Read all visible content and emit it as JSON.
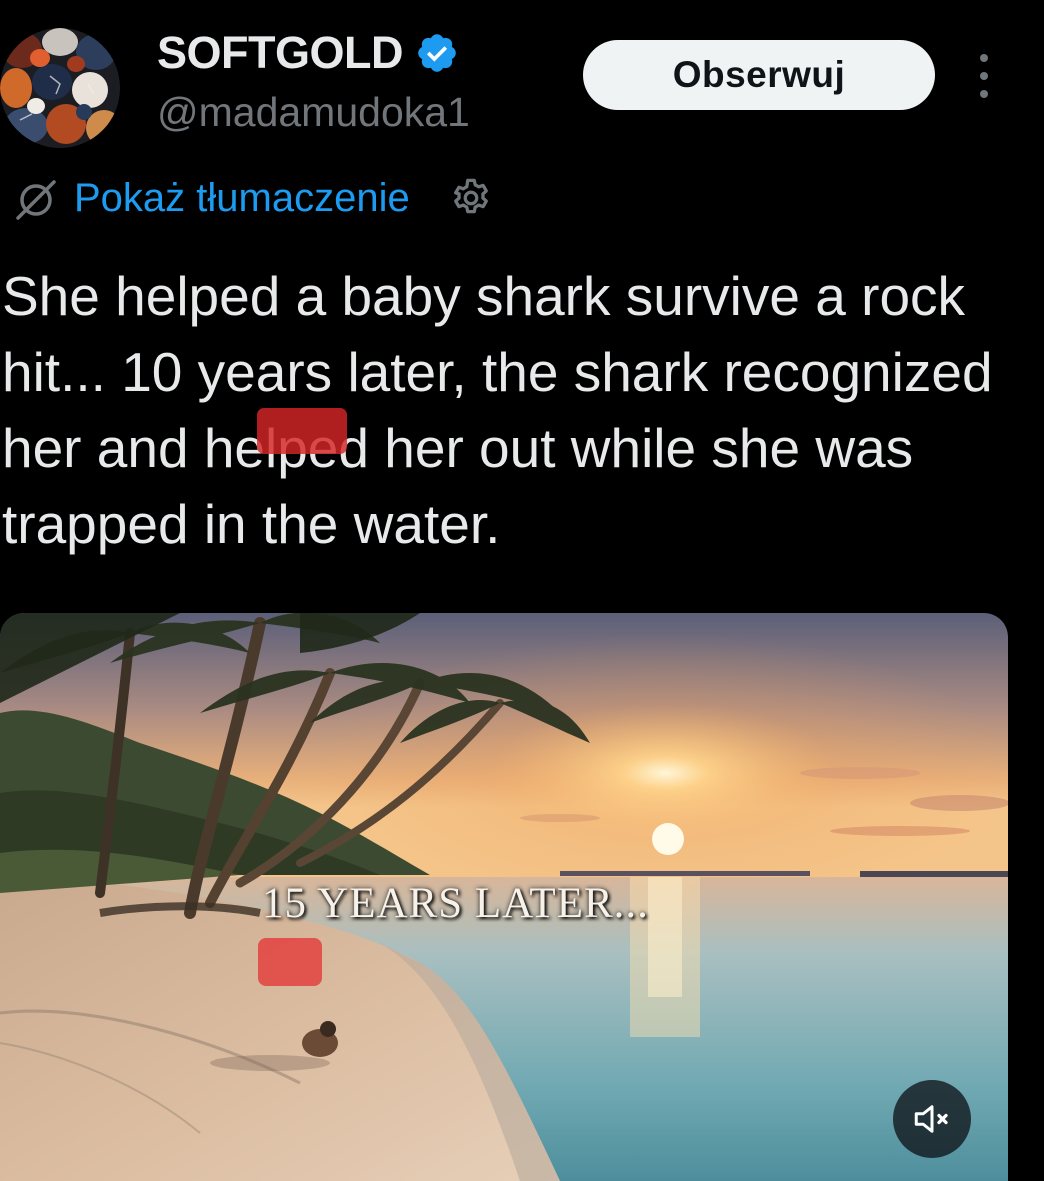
{
  "author": {
    "display_name": "SOFTGOLD",
    "handle": "@madamudoka1",
    "verified": true,
    "avatar_icon": "gemstone-collage-avatar"
  },
  "actions": {
    "follow_label": "Obserwuj",
    "more_icon": "more-vertical-icon"
  },
  "translate": {
    "label": "Pokaż tłumaczenie",
    "icon": "translate-slash-icon",
    "settings_icon": "gear-icon"
  },
  "tweet": {
    "text": "She helped a baby shark survive a rock hit... 10 years later, the shark recognized her and helped her out while she was trapped in the water."
  },
  "media": {
    "type": "video",
    "overlay_text": "15 YEARS LATER...",
    "scene": "sunset-beach-with-palm-trees",
    "mute_icon": "speaker-muted-icon",
    "muted": true
  },
  "colors": {
    "background": "#000000",
    "text_primary": "#e7e9ea",
    "text_secondary": "#71767b",
    "link": "#1d9bf0",
    "verified": "#1d9bf0",
    "follow_button_bg": "#eff3f4",
    "redaction": "#d62626"
  }
}
